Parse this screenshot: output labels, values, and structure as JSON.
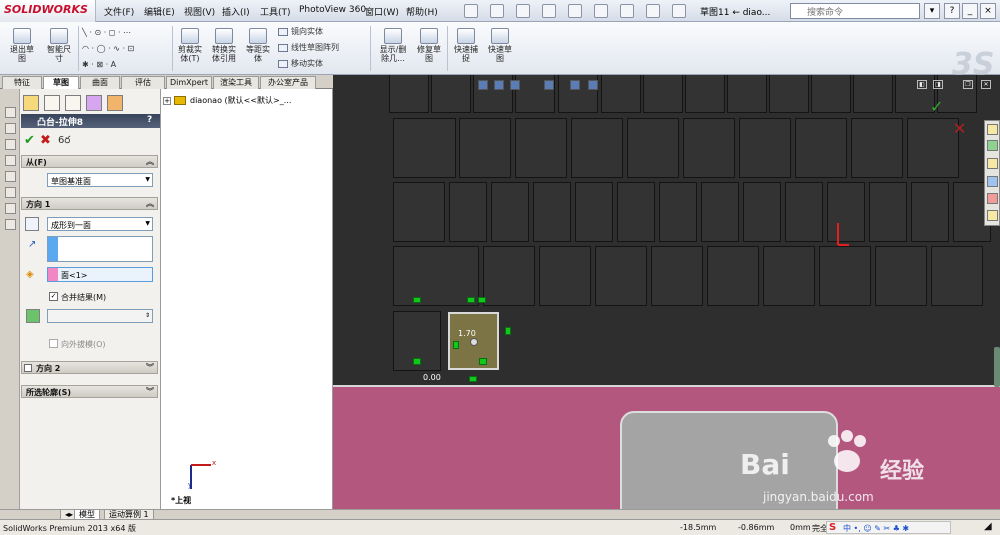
{
  "app": {
    "brand": "SOLIDWORKS",
    "menu": [
      "文件(F)",
      "编辑(E)",
      "视图(V)",
      "插入(I)",
      "工具(T)",
      "PhotoView 360",
      "窗口(W)",
      "帮助(H)"
    ],
    "doc_title": "草图11 ← diao...",
    "search_placeholder": "搜索命令",
    "help": "?"
  },
  "ribbon": {
    "buttons": [
      {
        "label": "退出草\n图"
      },
      {
        "label": "智能尺\n寸"
      },
      {
        "label": "剪裁实\n体(T)"
      },
      {
        "label": "转换实\n体引用"
      },
      {
        "label": "等距实\n体"
      },
      {
        "label": "显示/删\n除几..."
      },
      {
        "label": "修复草\n图"
      },
      {
        "label": "快速捕\n捉"
      },
      {
        "label": "快速草\n图"
      }
    ],
    "small": [
      "镜向实体",
      "线性草图阵列",
      "移动实体"
    ]
  },
  "tabs": [
    "特征",
    "草图",
    "曲面",
    "评估",
    "DimXpert",
    "渲染工具",
    "办公室产品"
  ],
  "active_tab": "草图",
  "property_manager": {
    "title": "凸台-拉伸8",
    "help": "?",
    "sections": {
      "from": {
        "label": "从(F)",
        "value": "草图基准面"
      },
      "direction1": {
        "label": "方向 1",
        "end_condition": "成形到一面",
        "face": "面<1>",
        "merge_label": "合并结果(M)",
        "draft_label": "向外拔模(O)"
      },
      "direction2": {
        "label": "方向 2"
      },
      "contours": {
        "label": "所选轮廓(S)"
      }
    }
  },
  "tree": {
    "root": "diaonao  (默认<<默认>_..."
  },
  "view_label": "*上视",
  "axis": {
    "x": "x",
    "y": "y"
  },
  "dimensions": {
    "a": "1.70",
    "b": "0.00"
  },
  "bottom_tabs": [
    "模型",
    "运动算例 1"
  ],
  "status": {
    "product": "SolidWorks Premium 2013 x64 版",
    "x": "-18.5mm",
    "y": "-0.86mm",
    "z": "0mm",
    "state": "完全"
  },
  "ime": {
    "brand": "S",
    "chars": "中 •, ☺ ✎ ✂ ♣ ✱"
  },
  "watermark": {
    "brand": "Bai",
    "brand2": "经验",
    "url": "jingyan.baidu.com",
    "icon": "paw-icon"
  }
}
